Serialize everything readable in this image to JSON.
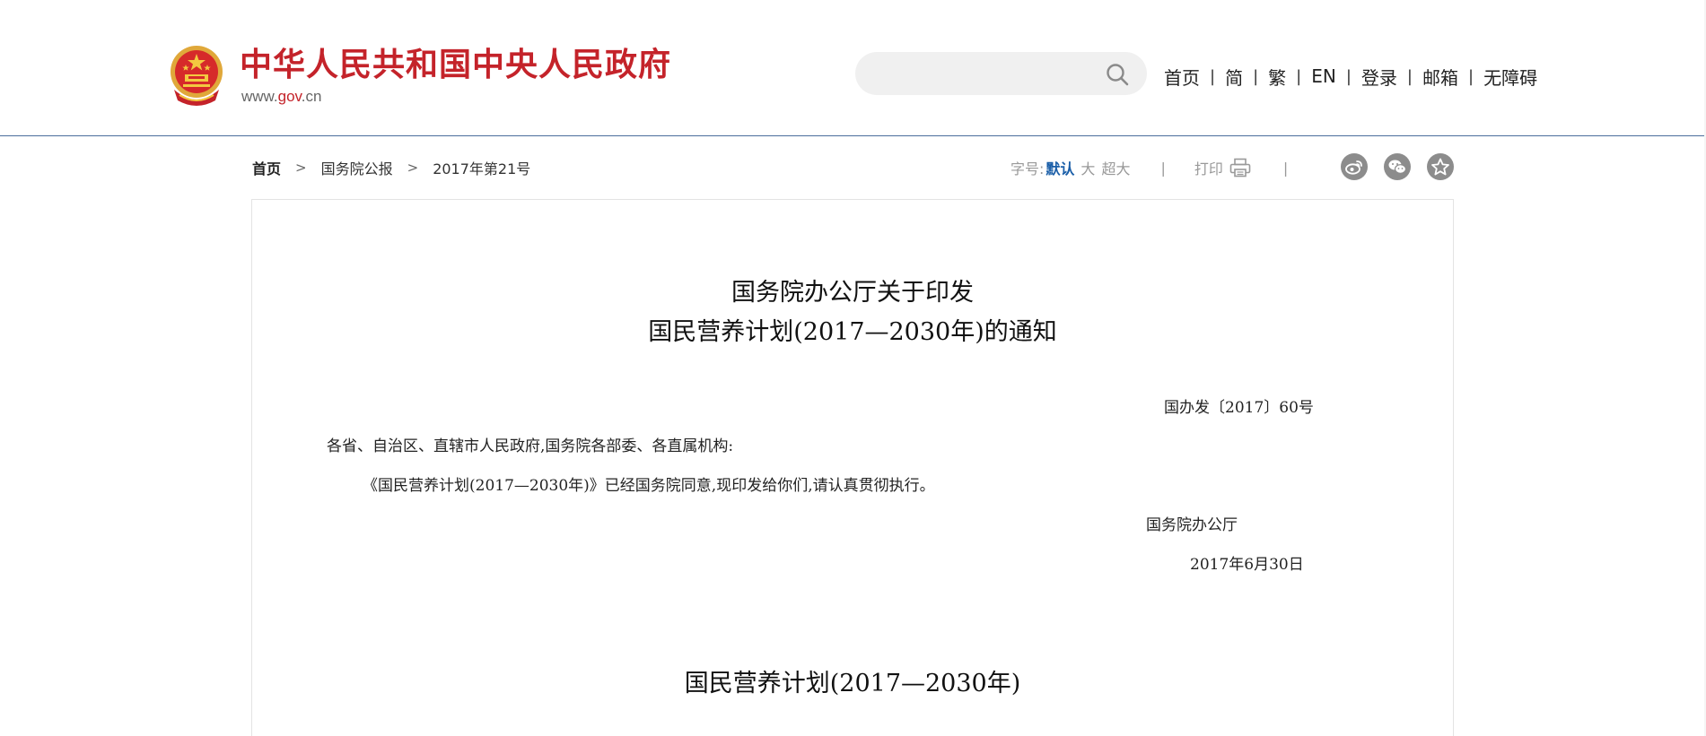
{
  "header": {
    "site_title": "中华人民共和国中央人民政府",
    "site_domain_prefix": "www.",
    "site_domain_brand": "gov",
    "site_domain_suffix": ".cn",
    "search": {
      "value": "",
      "placeholder": ""
    },
    "nav": [
      {
        "label": "首页"
      },
      {
        "label": "简"
      },
      {
        "label": "繁"
      },
      {
        "label": "EN"
      },
      {
        "label": "登录"
      },
      {
        "label": "邮箱"
      },
      {
        "label": "无障碍"
      }
    ],
    "nav_separator": "|"
  },
  "breadcrumb": {
    "items": [
      "首页",
      "国务院公报",
      "2017年第21号"
    ],
    "separator": ">"
  },
  "toolbar": {
    "font_size_label": "字号:",
    "font_size_options": [
      "默认",
      "大",
      "超大"
    ],
    "font_size_selected": "默认",
    "divider": "|",
    "print_label": "打印",
    "share": [
      "weibo-icon",
      "wechat-icon",
      "favorite-icon"
    ]
  },
  "article": {
    "title_line1": "国务院办公厅关于印发",
    "title_line2": "国民营养计划(2017—2030年)的通知",
    "doc_number": "国办发〔2017〕60号",
    "addressee": "各省、自治区、直辖市人民政府,国务院各部委、各直属机构:",
    "body": "《国民营养计划(2017—2030年)》已经国务院同意,现印发给你们,请认真贯彻执行。",
    "issuer": "国务院办公厅",
    "date": "2017年6月30日",
    "plan_title": "国民营养计划(2017—2030年)"
  },
  "colors": {
    "brand_red": "#c4232a",
    "header_rule": "#4b6e9c",
    "active_link": "#1a5ea8",
    "share_grey": "#8c8c8c"
  }
}
